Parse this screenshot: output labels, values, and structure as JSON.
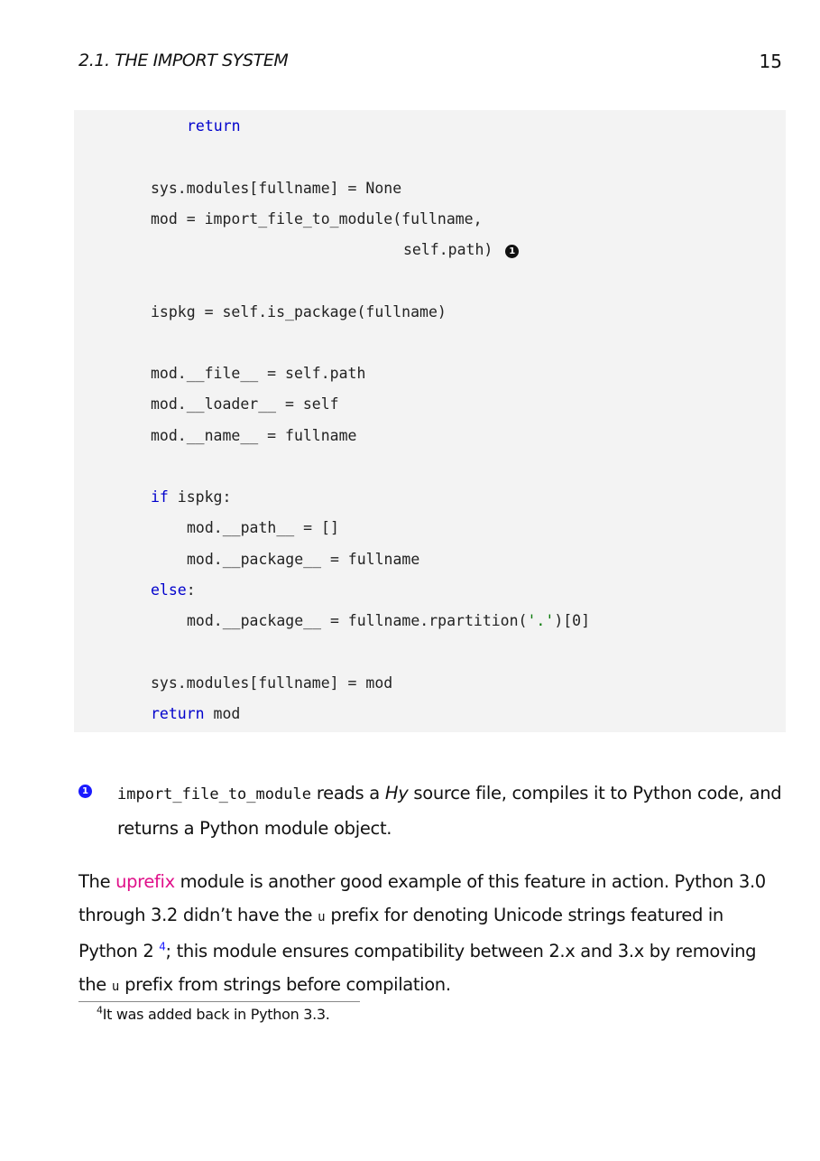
{
  "header": {
    "running_title": "2.1.  THE IMPORT SYSTEM",
    "page_number": "15"
  },
  "code": {
    "l1": "return",
    "l2": "sys.modules[fullname] = None",
    "l3": "mod = import_file_to_module(fullname,",
    "l4": "self.path)",
    "l4_callout": "1",
    "l5": "ispkg = self.is_package(fullname)",
    "l6": "mod.__file__ = self.path",
    "l7": "mod.__loader__ = self",
    "l8": "mod.__name__ = fullname",
    "l9_kw": "if",
    "l9_rest": " ispkg:",
    "l10": "mod.__path__ = []",
    "l11": "mod.__package__ = fullname",
    "l12_kw": "else",
    "l12_rest": ":",
    "l13_a": "mod.__package__ = fullname.rpartition(",
    "l13_str": "'.'",
    "l13_b": ")[0]",
    "l14": "sys.modules[fullname] = mod",
    "l15_kw": "return",
    "l15_rest": " mod"
  },
  "annotation": {
    "bullet": "1",
    "func": "import_file_to_module",
    "t1": " reads a ",
    "hy": "Hy",
    "t2": " source file, compiles it to Python code, and returns a Python module object."
  },
  "paragraph": {
    "p1": "The ",
    "link": "uprefix",
    "p2": " module is another good example of this feature in action.  Python 3.0 through 3.2 didn’t have the ",
    "u1": "u",
    "p3": " prefix for denoting Unicode strings featured in Python 2 ",
    "fnref": "4",
    "p4": "; this module ensures compatibility between 2.x and 3.x by removing the ",
    "u2": "u",
    "p5": " prefix from strings before compilation."
  },
  "footnote": {
    "mark": "4",
    "text": "It was added back in Python 3.3."
  }
}
